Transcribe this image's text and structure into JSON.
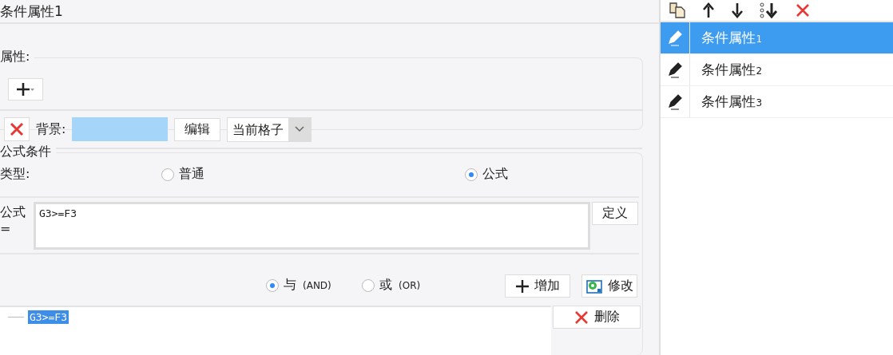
{
  "title": "条件属性1",
  "attributes": {
    "legend": "属性:",
    "background": {
      "label": "背景:",
      "color": "#a5d5f8",
      "edit_button": "编辑",
      "scope": "当前格子"
    }
  },
  "formula_condition": {
    "legend": "公式条件",
    "type_label": "类型:",
    "types": [
      {
        "label": "普通",
        "selected": false
      },
      {
        "label": "公式",
        "selected": true
      }
    ],
    "formula_label": "公式=",
    "formula_value": "G3>=F3",
    "define_button": "定义",
    "logic": [
      {
        "label": "与",
        "suffix": "(AND)",
        "selected": true
      },
      {
        "label": "或",
        "suffix": "(OR)",
        "selected": false
      }
    ],
    "add_button": "增加",
    "modify_button": "修改",
    "delete_button": "删除",
    "conditions": [
      {
        "text": "G3>=F3",
        "selected": true
      }
    ]
  },
  "properties_list": [
    {
      "label": "条件属性",
      "index": "1",
      "selected": true
    },
    {
      "label": "条件属性",
      "index": "2",
      "selected": false
    },
    {
      "label": "条件属性",
      "index": "3",
      "selected": false
    }
  ]
}
